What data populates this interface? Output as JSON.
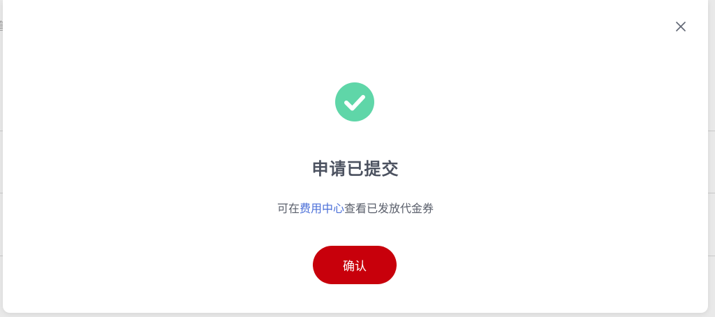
{
  "background": {
    "edge_glyph": "套"
  },
  "modal": {
    "close_icon": "close-icon",
    "status_icon": "check-circle-icon",
    "status_color": "#5fd6a8",
    "title": "申请已提交",
    "description": {
      "prefix": "可在",
      "link_text": "费用中心",
      "suffix": "查看已发放代金券",
      "link_color": "#4b6fd8"
    },
    "confirm_button": {
      "label": "确认",
      "color": "#c8000b"
    }
  }
}
